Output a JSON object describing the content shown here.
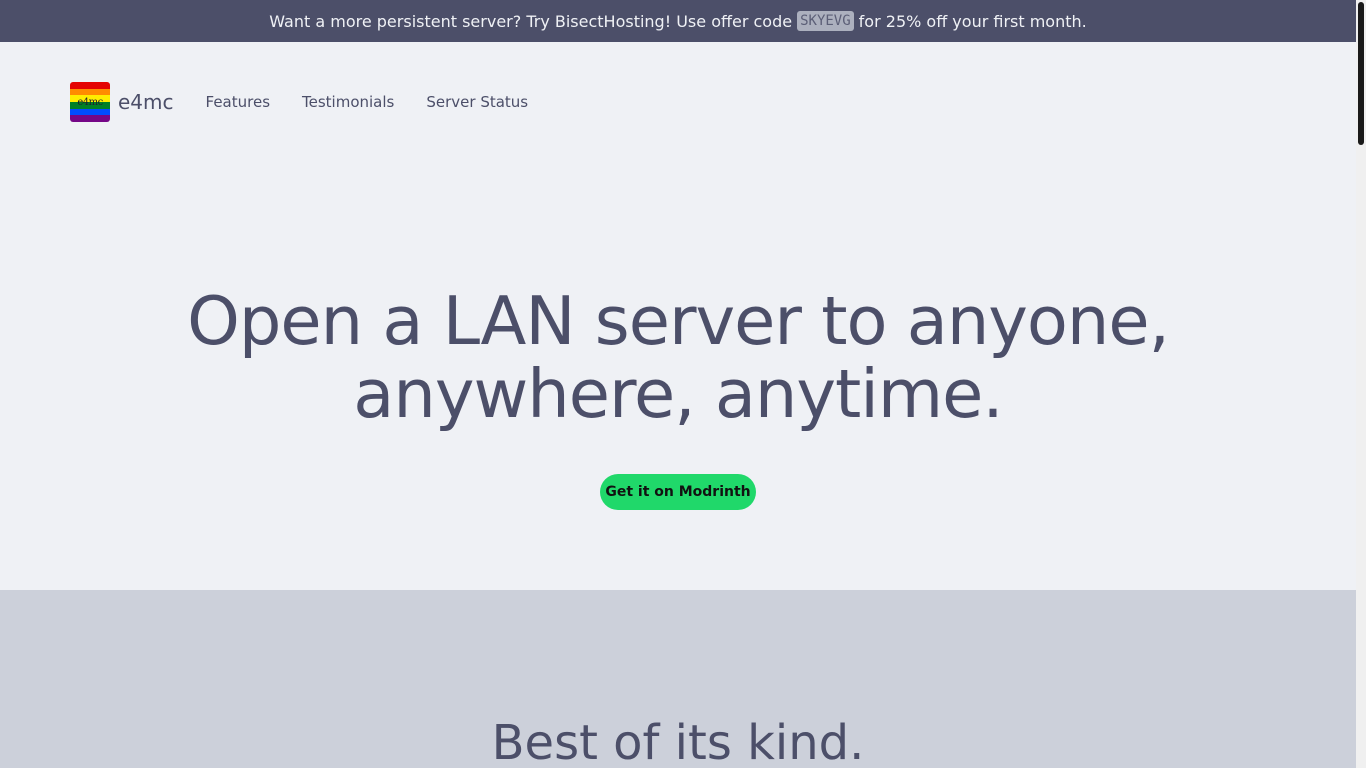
{
  "promo": {
    "text_before": "Want a more persistent server? Try BisectHosting! Use offer code",
    "code": "SKYEVG",
    "text_after": "for 25% off your first month."
  },
  "nav": {
    "logo_text": "e4mc",
    "brand": "e4mc",
    "links": [
      "Features",
      "Testimonials",
      "Server Status"
    ]
  },
  "hero": {
    "title_line1": "Open a LAN server to anyone,",
    "title_line2": "anywhere, anytime.",
    "cta_label": "Get it on Modrinth",
    "cta_color": "#20d86a"
  },
  "features": {
    "heading": "Best of its kind."
  },
  "colors": {
    "banner_bg": "#4c4f69",
    "page_bg": "#eff1f5",
    "text": "#4c4f69",
    "section_bg": "#ccd0da",
    "logo_stripes": [
      "#e40303",
      "#ff8c00",
      "#ffed00",
      "#008026",
      "#004dff",
      "#750787"
    ]
  }
}
